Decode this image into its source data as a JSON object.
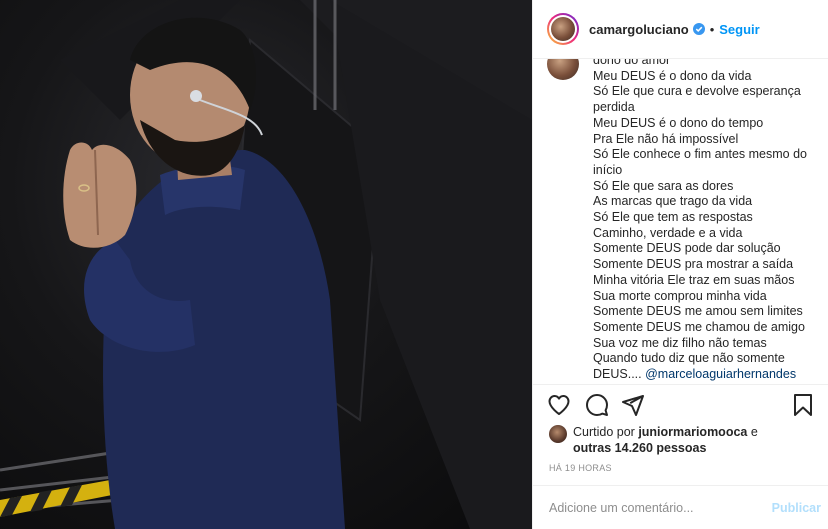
{
  "post": {
    "username": "camargoluciano",
    "dot": "•",
    "follow_label": "Seguir",
    "verified_icon": "verified-badge-icon",
    "more_icon": "more-options-icon"
  },
  "caption": {
    "lines": [
      "dono do amor",
      "Meu DEUS é o dono da vida",
      "Só Ele que cura e devolve esperança",
      "perdida",
      "Meu DEUS é o dono do tempo",
      "Pra Ele não há impossível",
      "Só Ele conhece o fim antes mesmo do",
      "início",
      "Só Ele que sara as dores",
      "As marcas que trago da vida",
      "Só Ele que tem as respostas",
      "Caminho, verdade e a vida",
      "Somente DEUS pode dar solução",
      "Somente DEUS pra mostrar a saída",
      "Minha vitória Ele traz em suas mãos",
      "Sua morte comprou minha vida",
      "Somente DEUS me amou sem limites",
      "Somente DEUS me chamou de amigo",
      "Sua voz me diz filho não temas",
      "Quando tudo diz que não somente"
    ],
    "last_line_prefix": "DEUS.... ",
    "last_line_mention": "@marceloaguiarhernandes"
  },
  "actions": {
    "like_icon": "heart-icon",
    "comment_icon": "comment-icon",
    "share_icon": "share-icon",
    "save_icon": "bookmark-icon"
  },
  "likes": {
    "prefix": "Curtido por ",
    "user": "juniormariomooca",
    "connector": " e",
    "others": "outras 14.260 pessoas"
  },
  "timestamp": "HÁ 19 HORAS",
  "comment": {
    "placeholder": "Adicione um comentário...",
    "publish_label": "Publicar"
  },
  "colors": {
    "accent": "#0095f6",
    "publish_disabled": "#b2dffc",
    "mention": "#00376b",
    "muted": "#8e8e8e",
    "suit": "#1f2a55"
  }
}
